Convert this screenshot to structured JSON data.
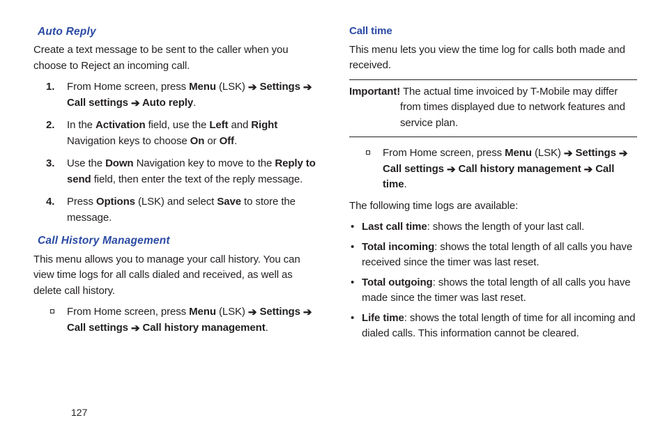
{
  "arrow": "➔",
  "pageNumber": "127",
  "left": {
    "autoReply": {
      "heading": "Auto Reply",
      "intro": "Create a text message to be sent to the caller when you choose to Reject an incoming call.",
      "steps": {
        "s1": {
          "num": "1.",
          "p1": "From Home screen, press ",
          "b1": "Menu",
          "p2": " (LSK) ",
          "b2": " Settings ",
          "b3": "Call settings ",
          "b4": " Auto reply",
          "end": "."
        },
        "s2": {
          "num": "2.",
          "p1": "In the ",
          "b1": "Activation",
          "p2": " field, use the ",
          "b2": "Left",
          "p3": " and ",
          "b3": "Right",
          "p4": " Navigation keys to choose ",
          "b4": "On",
          "p5": " or ",
          "b5": "Off",
          "end": "."
        },
        "s3": {
          "num": "3.",
          "p1": "Use the ",
          "b1": "Down",
          "p2": " Navigation key to move to the ",
          "b2": "Reply to send",
          "p3": " field, then enter the text of the reply message."
        },
        "s4": {
          "num": "4.",
          "p1": "Press ",
          "b1": "Options",
          "p2": " (LSK) and select ",
          "b2": "Save",
          "p3": " to store the message."
        }
      }
    },
    "callHistory": {
      "heading": "Call History Management",
      "intro": "This menu allows you to manage your call history. You can view time logs for all calls dialed and received, as well as delete call history.",
      "path": {
        "p1": "From Home screen, press ",
        "b1": "Menu",
        "p2": " (LSK) ",
        "b2": " Settings ",
        "b3": "Call settings ",
        "b4": " Call history management",
        "end": "."
      }
    }
  },
  "right": {
    "callTime": {
      "heading": "Call time",
      "intro": "This menu lets you view the time log for calls both made and received.",
      "important": {
        "label": "Important!",
        "text": " The actual time invoiced by T-Mobile may differ from times displayed due to network features and service plan."
      },
      "path": {
        "p1": "From Home screen, press ",
        "b1": "Menu",
        "p2": " (LSK) ",
        "b2": " Settings ",
        "b3": "Call settings ",
        "b4": " Call history management ",
        "b5": " Call time",
        "end": "."
      },
      "logsIntro": "The following time logs are available:",
      "logs": {
        "l1": {
          "b": "Last call time",
          "t": ": shows the length of your last call."
        },
        "l2": {
          "b": "Total incoming",
          "t": ": shows the total length of all calls you have received since the timer was last reset."
        },
        "l3": {
          "b": "Total outgoing",
          "t": ": shows the total length of all calls you have made since the timer was last reset."
        },
        "l4": {
          "b": "Life time",
          "t": ": shows the total length of time for all incoming and dialed calls. This information cannot be cleared."
        }
      }
    }
  }
}
